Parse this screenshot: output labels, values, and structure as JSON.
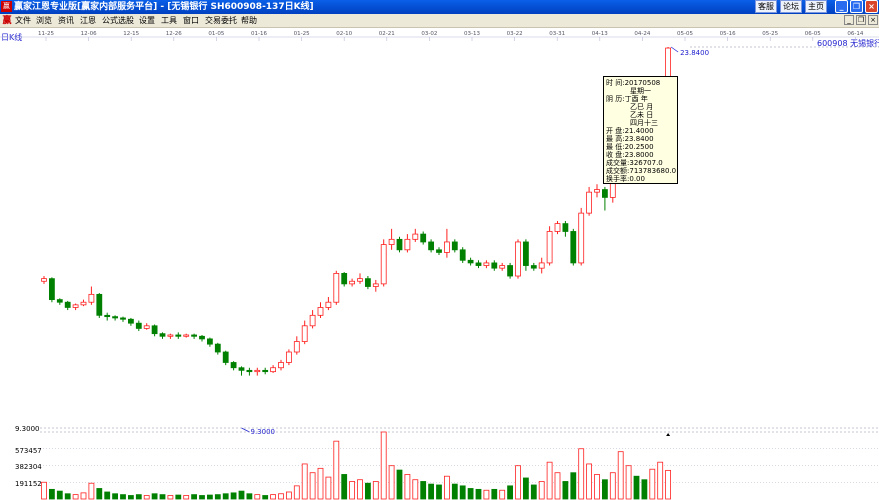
{
  "window": {
    "title": "赢家江恩专业版[赢家内部服务平台] - [无锡银行   SH600908-137日K线]",
    "links": [
      "客服",
      "论坛",
      "主页"
    ]
  },
  "menu": [
    "文件",
    "浏览",
    "资讯",
    "江恩",
    "公式选股",
    "设置",
    "工具",
    "窗口",
    "交易委托",
    "帮助"
  ],
  "period_tag": "日K线",
  "stock_label": "600908 无锡银行",
  "date_ticks": [
    "11-25",
    "12-06",
    "12-15",
    "12-26",
    "01-05",
    "01-16",
    "01-25",
    "02-10",
    "02-21",
    "03-02",
    "03-13",
    "03-22",
    "03-31",
    "04-13",
    "04-24",
    "05-05",
    "05-16",
    "05-25",
    "06-05",
    "06-14"
  ],
  "price": {
    "low_label": "9.3000",
    "min_marker": "9.3000",
    "max_marker": "23.8400"
  },
  "volume_axis": [
    "573457",
    "382304",
    "191152"
  ],
  "tooltip": {
    "time_label": "时 间:",
    "time": "20170508",
    "weekday": "星期一",
    "lunar_label": "阴 历:",
    "lunar_year": "丁酉 年",
    "lunar_month": "乙巳 月",
    "lunar_day": "乙未 日",
    "lunar_text": "四月十三",
    "open_label": "开 盘:",
    "open": "21.4000",
    "high_label": "最 高:",
    "high": "23.8400",
    "low_label": "最 低:",
    "low": "20.2500",
    "close_label": "收 盘:",
    "close": "23.8000",
    "vol_label": "成交量:",
    "vol": "326707.0",
    "amt_label": "成交额:",
    "amt": "713783680.0",
    "turn_label": "换手率:",
    "turn": "0.00"
  },
  "colors": {
    "up": "#ff2020",
    "down": "#008000",
    "grid": "#b8b8d8",
    "label": "#2020d0"
  },
  "chart_data": {
    "type": "candlestick",
    "price_range": [
      9.3,
      23.84
    ],
    "candles": [
      {
        "o": 14.9,
        "c": 15.0,
        "h": 15.1,
        "l": 14.8
      },
      {
        "o": 15.0,
        "c": 14.2,
        "h": 15.05,
        "l": 14.1
      },
      {
        "o": 14.2,
        "c": 14.1,
        "h": 14.25,
        "l": 14.0
      },
      {
        "o": 14.1,
        "c": 13.9,
        "h": 14.15,
        "l": 13.8
      },
      {
        "o": 13.9,
        "c": 14.0,
        "h": 14.05,
        "l": 13.8
      },
      {
        "o": 14.0,
        "c": 14.1,
        "h": 14.2,
        "l": 13.95
      },
      {
        "o": 14.1,
        "c": 14.4,
        "h": 14.7,
        "l": 14.0
      },
      {
        "o": 14.4,
        "c": 13.6,
        "h": 14.45,
        "l": 13.5
      },
      {
        "o": 13.6,
        "c": 13.55,
        "h": 13.7,
        "l": 13.4
      },
      {
        "o": 13.55,
        "c": 13.5,
        "h": 13.6,
        "l": 13.4
      },
      {
        "o": 13.5,
        "c": 13.45,
        "h": 13.55,
        "l": 13.35
      },
      {
        "o": 13.45,
        "c": 13.3,
        "h": 13.5,
        "l": 13.2
      },
      {
        "o": 13.3,
        "c": 13.1,
        "h": 13.4,
        "l": 13.0
      },
      {
        "o": 13.1,
        "c": 13.2,
        "h": 13.3,
        "l": 13.05
      },
      {
        "o": 13.2,
        "c": 12.9,
        "h": 13.25,
        "l": 12.8
      },
      {
        "o": 12.9,
        "c": 12.8,
        "h": 12.95,
        "l": 12.7
      },
      {
        "o": 12.8,
        "c": 12.85,
        "h": 12.9,
        "l": 12.7
      },
      {
        "o": 12.85,
        "c": 12.8,
        "h": 12.95,
        "l": 12.7
      },
      {
        "o": 12.8,
        "c": 12.85,
        "h": 12.9,
        "l": 12.75
      },
      {
        "o": 12.85,
        "c": 12.8,
        "h": 12.9,
        "l": 12.7
      },
      {
        "o": 12.8,
        "c": 12.7,
        "h": 12.85,
        "l": 12.6
      },
      {
        "o": 12.7,
        "c": 12.5,
        "h": 12.75,
        "l": 12.4
      },
      {
        "o": 12.5,
        "c": 12.2,
        "h": 12.55,
        "l": 12.1
      },
      {
        "o": 12.2,
        "c": 11.8,
        "h": 12.25,
        "l": 11.7
      },
      {
        "o": 11.8,
        "c": 11.6,
        "h": 11.85,
        "l": 11.5
      },
      {
        "o": 11.6,
        "c": 11.5,
        "h": 11.65,
        "l": 11.3
      },
      {
        "o": 11.5,
        "c": 11.45,
        "h": 11.6,
        "l": 11.3
      },
      {
        "o": 11.45,
        "c": 11.5,
        "h": 11.6,
        "l": 11.3
      },
      {
        "o": 11.5,
        "c": 11.45,
        "h": 11.6,
        "l": 11.35
      },
      {
        "o": 11.45,
        "c": 11.6,
        "h": 11.7,
        "l": 11.4
      },
      {
        "o": 11.6,
        "c": 11.8,
        "h": 11.9,
        "l": 11.5
      },
      {
        "o": 11.8,
        "c": 12.2,
        "h": 12.3,
        "l": 11.7
      },
      {
        "o": 12.2,
        "c": 12.6,
        "h": 12.8,
        "l": 12.1
      },
      {
        "o": 12.6,
        "c": 13.2,
        "h": 13.4,
        "l": 12.5
      },
      {
        "o": 13.2,
        "c": 13.6,
        "h": 13.8,
        "l": 13.1
      },
      {
        "o": 13.6,
        "c": 13.9,
        "h": 14.1,
        "l": 13.5
      },
      {
        "o": 13.9,
        "c": 14.1,
        "h": 14.3,
        "l": 13.8
      },
      {
        "o": 14.1,
        "c": 15.2,
        "h": 15.3,
        "l": 14.0
      },
      {
        "o": 15.2,
        "c": 14.8,
        "h": 15.25,
        "l": 14.7
      },
      {
        "o": 14.8,
        "c": 14.9,
        "h": 15.0,
        "l": 14.7
      },
      {
        "o": 14.9,
        "c": 15.0,
        "h": 15.2,
        "l": 14.8
      },
      {
        "o": 15.0,
        "c": 14.7,
        "h": 15.1,
        "l": 14.6
      },
      {
        "o": 14.7,
        "c": 14.8,
        "h": 14.95,
        "l": 14.5
      },
      {
        "o": 14.8,
        "c": 16.3,
        "h": 16.5,
        "l": 14.7
      },
      {
        "o": 16.3,
        "c": 16.5,
        "h": 16.9,
        "l": 16.1
      },
      {
        "o": 16.5,
        "c": 16.1,
        "h": 16.6,
        "l": 16.0
      },
      {
        "o": 16.1,
        "c": 16.5,
        "h": 16.7,
        "l": 16.0
      },
      {
        "o": 16.5,
        "c": 16.7,
        "h": 16.9,
        "l": 16.4
      },
      {
        "o": 16.7,
        "c": 16.4,
        "h": 16.8,
        "l": 16.3
      },
      {
        "o": 16.4,
        "c": 16.1,
        "h": 16.5,
        "l": 16.0
      },
      {
        "o": 16.1,
        "c": 16.0,
        "h": 16.2,
        "l": 15.9
      },
      {
        "o": 16.0,
        "c": 16.4,
        "h": 16.9,
        "l": 15.8
      },
      {
        "o": 16.4,
        "c": 16.1,
        "h": 16.5,
        "l": 16.0
      },
      {
        "o": 16.1,
        "c": 15.7,
        "h": 16.2,
        "l": 15.6
      },
      {
        "o": 15.7,
        "c": 15.6,
        "h": 15.8,
        "l": 15.5
      },
      {
        "o": 15.6,
        "c": 15.5,
        "h": 15.7,
        "l": 15.4
      },
      {
        "o": 15.5,
        "c": 15.6,
        "h": 15.7,
        "l": 15.4
      },
      {
        "o": 15.6,
        "c": 15.4,
        "h": 15.7,
        "l": 15.3
      },
      {
        "o": 15.4,
        "c": 15.5,
        "h": 15.6,
        "l": 15.3
      },
      {
        "o": 15.5,
        "c": 15.1,
        "h": 15.6,
        "l": 15.0
      },
      {
        "o": 15.1,
        "c": 16.4,
        "h": 16.5,
        "l": 15.0
      },
      {
        "o": 16.4,
        "c": 15.5,
        "h": 16.5,
        "l": 15.3
      },
      {
        "o": 15.5,
        "c": 15.4,
        "h": 15.6,
        "l": 15.3
      },
      {
        "o": 15.4,
        "c": 15.6,
        "h": 15.8,
        "l": 15.2
      },
      {
        "o": 15.6,
        "c": 16.8,
        "h": 17.0,
        "l": 15.5
      },
      {
        "o": 16.8,
        "c": 17.1,
        "h": 17.2,
        "l": 16.7
      },
      {
        "o": 17.1,
        "c": 16.8,
        "h": 17.2,
        "l": 16.6
      },
      {
        "o": 16.8,
        "c": 15.6,
        "h": 16.9,
        "l": 15.5
      },
      {
        "o": 15.6,
        "c": 17.5,
        "h": 17.7,
        "l": 15.5
      },
      {
        "o": 17.5,
        "c": 18.3,
        "h": 18.5,
        "l": 17.4
      },
      {
        "o": 18.3,
        "c": 18.4,
        "h": 18.6,
        "l": 18.1
      },
      {
        "o": 18.4,
        "c": 18.1,
        "h": 18.5,
        "l": 17.6
      },
      {
        "o": 18.1,
        "c": 19.0,
        "h": 19.3,
        "l": 17.9
      },
      {
        "o": 19.0,
        "c": 19.6,
        "h": 20.5,
        "l": 18.8
      },
      {
        "o": 19.6,
        "c": 20.4,
        "h": 20.6,
        "l": 19.4
      },
      {
        "o": 20.4,
        "c": 19.5,
        "h": 20.5,
        "l": 19.3
      },
      {
        "o": 19.5,
        "c": 18.8,
        "h": 19.6,
        "l": 18.7
      },
      {
        "o": 18.8,
        "c": 20.3,
        "h": 20.6,
        "l": 18.7
      },
      {
        "o": 20.3,
        "c": 21.4,
        "h": 21.6,
        "l": 20.2
      },
      {
        "o": 21.4,
        "c": 23.8,
        "h": 23.84,
        "l": 20.25
      }
    ],
    "volume_range": [
      0,
      764609
    ],
    "volumes": [
      191152,
      110000,
      90000,
      60000,
      50000,
      70000,
      180000,
      120000,
      80000,
      60000,
      50000,
      40000,
      50000,
      40000,
      60000,
      50000,
      40000,
      45000,
      40000,
      50000,
      40000,
      45000,
      50000,
      60000,
      70000,
      90000,
      60000,
      50000,
      40000,
      50000,
      60000,
      80000,
      150000,
      400000,
      300000,
      350000,
      250000,
      660000,
      280000,
      200000,
      220000,
      180000,
      200000,
      764609,
      380000,
      330000,
      280000,
      220000,
      200000,
      170000,
      160000,
      260000,
      170000,
      150000,
      120000,
      110000,
      100000,
      110000,
      100000,
      150000,
      380000,
      240000,
      160000,
      200000,
      420000,
      300000,
      200000,
      300000,
      573457,
      400000,
      280000,
      220000,
      300000,
      540000,
      380000,
      260000,
      220000,
      340000,
      420000,
      326707
    ],
    "vol_up": [
      true,
      false,
      false,
      false,
      true,
      true,
      true,
      false,
      false,
      false,
      false,
      false,
      false,
      true,
      false,
      false,
      true,
      false,
      true,
      false,
      false,
      false,
      false,
      false,
      false,
      false,
      false,
      true,
      false,
      true,
      true,
      true,
      true,
      true,
      true,
      true,
      true,
      true,
      false,
      true,
      true,
      false,
      true,
      true,
      true,
      false,
      true,
      true,
      false,
      false,
      false,
      true,
      false,
      false,
      false,
      false,
      true,
      false,
      true,
      false,
      true,
      false,
      false,
      true,
      true,
      true,
      false,
      false,
      true,
      true,
      true,
      false,
      true,
      true,
      true,
      false,
      false,
      true,
      true,
      true
    ]
  }
}
